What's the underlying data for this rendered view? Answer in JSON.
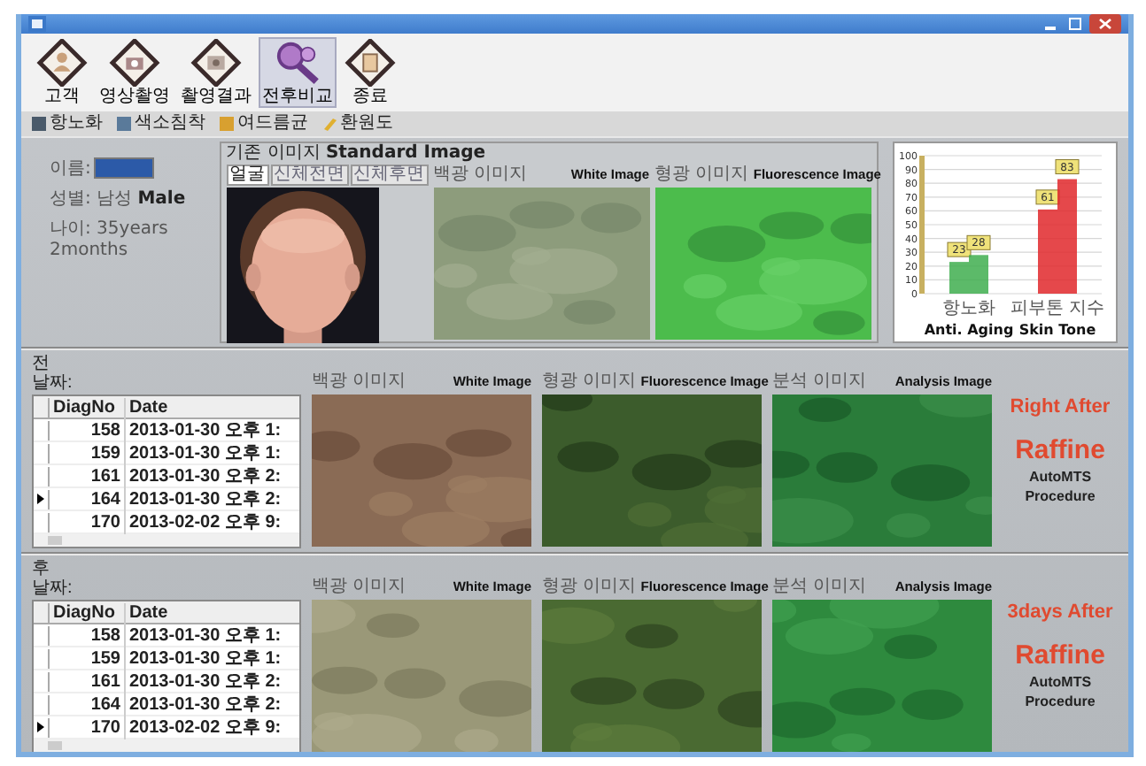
{
  "toolbar": [
    {
      "label": "고객",
      "selected": false
    },
    {
      "label": "영상촬영",
      "selected": false
    },
    {
      "label": "촬영결과",
      "selected": false
    },
    {
      "label": "전후비교",
      "selected": true
    },
    {
      "label": "종료",
      "selected": false
    }
  ],
  "menu_strip": [
    "항노화",
    "색소침착",
    "여드름균",
    "환원도"
  ],
  "patient": {
    "name_label": "이름:",
    "gender_label": "성별:",
    "gender_ko": "남성",
    "gender_en": "Male",
    "age_label": "나이:",
    "age": "35years 2months"
  },
  "standard": {
    "title_ko": "기존 이미지",
    "title_en": "Standard Image",
    "tabs": [
      {
        "label": "얼굴",
        "selected": true
      },
      {
        "label": "신체전면",
        "selected": false
      },
      {
        "label": "신체후면",
        "selected": false
      }
    ]
  },
  "top_images": [
    {
      "caption_ko": "백광 이미지",
      "caption_en": "White Image",
      "kind": "picture"
    },
    {
      "caption_ko": "형광 이미지",
      "caption_en": "Fluorescence Image",
      "kind": "picture"
    }
  ],
  "chart": {
    "captions": [
      "Anti. Aging",
      "Skin Tone"
    ],
    "chart_data": {
      "type": "bar",
      "categories": [
        "항노화",
        "피부톤 지수"
      ],
      "series": [
        {
          "colors": [
            "#3fae4f",
            "#e0282c"
          ],
          "values": [
            23,
            61
          ]
        },
        {
          "colors": [
            "#3fae4f",
            "#e0282c"
          ],
          "values": [
            28,
            83
          ]
        }
      ],
      "ylim": [
        0,
        100
      ],
      "yticks": [
        0,
        10,
        20,
        30,
        40,
        50,
        60,
        70,
        80,
        90,
        100
      ],
      "grid": true,
      "data_labels": true
    }
  },
  "sections": [
    {
      "title": "전",
      "date_label": "날짜:",
      "columns": [
        "DiagNo",
        "Date"
      ],
      "rows": [
        {
          "no": "158",
          "date": "2013-01-30 오후 1:",
          "selected": false
        },
        {
          "no": "159",
          "date": "2013-01-30 오후 1:",
          "selected": false
        },
        {
          "no": "161",
          "date": "2013-01-30 오후 2:",
          "selected": false
        },
        {
          "no": "164",
          "date": "2013-01-30 오후 2:",
          "selected": true
        },
        {
          "no": "170",
          "date": "2013-02-02 오후 9:",
          "selected": false
        }
      ],
      "images": [
        {
          "caption_ko": "백광 이미지",
          "caption_en": "White Image",
          "kind": "picture"
        },
        {
          "caption_ko": "형광 이미지",
          "caption_en": "Fluorescence Image",
          "kind": "picture"
        },
        {
          "caption_ko": "분석 이미지",
          "caption_en": "Analysis Image",
          "kind": "picture"
        }
      ],
      "status": "Right After",
      "brand": "Raffine",
      "lines": [
        "AutoMTS",
        "Procedure"
      ]
    },
    {
      "title": "후",
      "date_label": "날짜:",
      "columns": [
        "DiagNo",
        "Date"
      ],
      "rows": [
        {
          "no": "158",
          "date": "2013-01-30 오후 1:",
          "selected": false
        },
        {
          "no": "159",
          "date": "2013-01-30 오후 1:",
          "selected": false
        },
        {
          "no": "161",
          "date": "2013-01-30 오후 2:",
          "selected": false
        },
        {
          "no": "164",
          "date": "2013-01-30 오후 2:",
          "selected": false
        },
        {
          "no": "170",
          "date": "2013-02-02 오후 9:",
          "selected": true
        }
      ],
      "images": [
        {
          "caption_ko": "백광 이미지",
          "caption_en": "White Image",
          "kind": "picture"
        },
        {
          "caption_ko": "형광 이미지",
          "caption_en": "Fluorescence Image",
          "kind": "picture"
        },
        {
          "caption_ko": "분석 이미지",
          "caption_en": "Analysis Image",
          "kind": "picture"
        }
      ],
      "status": "3days After",
      "brand": "Raffine",
      "lines": [
        "AutoMTS",
        "Procedure"
      ]
    }
  ]
}
